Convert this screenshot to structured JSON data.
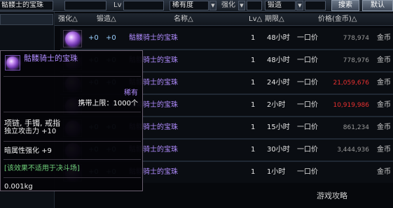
{
  "topbar": {
    "search_value": "骷髅士的宝珠",
    "lv_label": "Lv",
    "rarity_value": "稀有度",
    "enhance_label": "强化",
    "forge_label": "锻造",
    "search_button": "搜索",
    "default_button": "默认"
  },
  "columns": {
    "enhance": "强化△",
    "forge": "锻造△",
    "name": "名称△",
    "lv": "Lv△",
    "period": "期限△",
    "price": "价格(金币)△"
  },
  "rows": [
    {
      "enhance": "+0",
      "forge": "+0",
      "name": "骷髅骑士的宝珠",
      "lv": "1",
      "time": "48小时",
      "type": "一口价",
      "price": "778,974",
      "price_color": "#9a9a9a",
      "currency": "金币"
    },
    {
      "enhance": "+0",
      "forge": "+0",
      "name": "骷髅骑士的宝珠",
      "lv": "1",
      "time": "48小时",
      "type": "一口价",
      "price": "778,976",
      "price_color": "#9a9a9a",
      "currency": "金币"
    },
    {
      "enhance": "+0",
      "forge": "+0",
      "name": "骷髅骑士的宝珠",
      "lv": "1",
      "time": "24小时",
      "type": "一口价",
      "price": "21,059,676",
      "price_color": "#e83030",
      "currency": "金币"
    },
    {
      "enhance": "+0",
      "forge": "+0",
      "name": "骷髅骑士的宝珠",
      "lv": "1",
      "time": "2小时",
      "type": "一口价",
      "price": "10,919,986",
      "price_color": "#e83030",
      "currency": "金币"
    },
    {
      "enhance": "+0",
      "forge": "+0",
      "name": "骷髅骑士的宝珠",
      "lv": "1",
      "time": "15小时",
      "type": "一口价",
      "price": "861,234",
      "price_color": "#9a9a9a",
      "currency": "金币"
    },
    {
      "enhance": "+0",
      "forge": "+0",
      "name": "骷髅骑士的宝珠",
      "lv": "1",
      "time": "30小时",
      "type": "一口价",
      "price": "3,444,936",
      "price_color": "#9a9a9a",
      "currency": "金币"
    },
    {
      "enhance": "+0",
      "forge": "+0",
      "name": "骷髅骑士的宝珠",
      "lv": "1",
      "time": "1小时",
      "type": "一口价",
      "price": "",
      "price_color": "#9a9a9a",
      "currency": "金币"
    }
  ],
  "tooltip": {
    "title": "骷髅骑士的宝珠",
    "rarity": "稀有",
    "carry_limit": "携带上限：1000个",
    "slots": "项链, 手镯, 戒指",
    "attack": "独立攻击力 +10",
    "dark_enhance": "暗属性强化 +9",
    "note": "[该效果不适用于决斗场]",
    "weight": "0.001kg"
  },
  "watermark": {
    "text": "游戏攻略"
  }
}
